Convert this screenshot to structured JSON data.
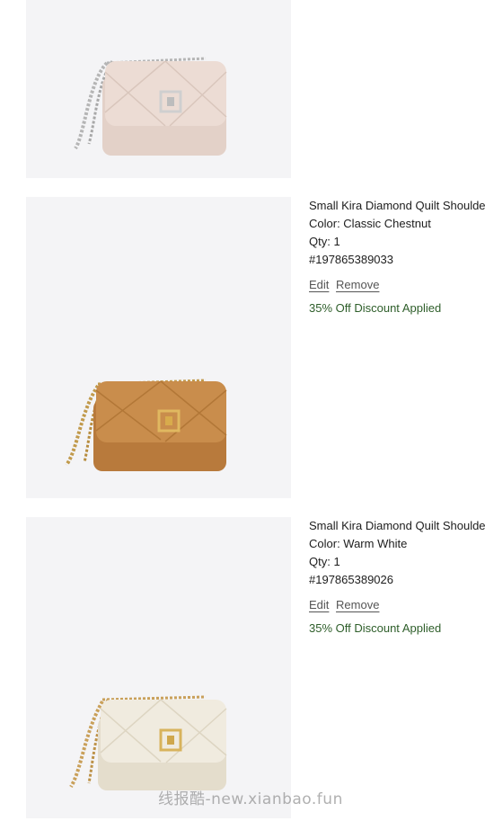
{
  "items": [
    {
      "image_alt": "Small Kira Diamond Quilt Shoulder Bag - light pink",
      "bag_color": "#e9d9d1",
      "hardware": "silver"
    },
    {
      "name": "Small Kira Diamond Quilt Shoulde",
      "color_line": "Color: Classic Chestnut",
      "qty_line": "Qty: 1",
      "sku_line": "#197865389033",
      "edit_label": "Edit",
      "remove_label": "Remove",
      "discount": "35% Off Discount Applied",
      "bag_color": "#c68a48",
      "hardware": "gold"
    },
    {
      "name": "Small Kira Diamond Quilt Shoulde",
      "color_line": "Color: Warm White",
      "qty_line": "Qty: 1",
      "sku_line": "#197865389026",
      "edit_label": "Edit",
      "remove_label": "Remove",
      "discount": "35% Off Discount Applied",
      "bag_color": "#ede8dc",
      "hardware": "gold"
    }
  ],
  "watermark": "线报酷-new.xianbao.fun",
  "colors": {
    "discount": "#2e5e2a",
    "image_bg": "#f4f4f6"
  }
}
